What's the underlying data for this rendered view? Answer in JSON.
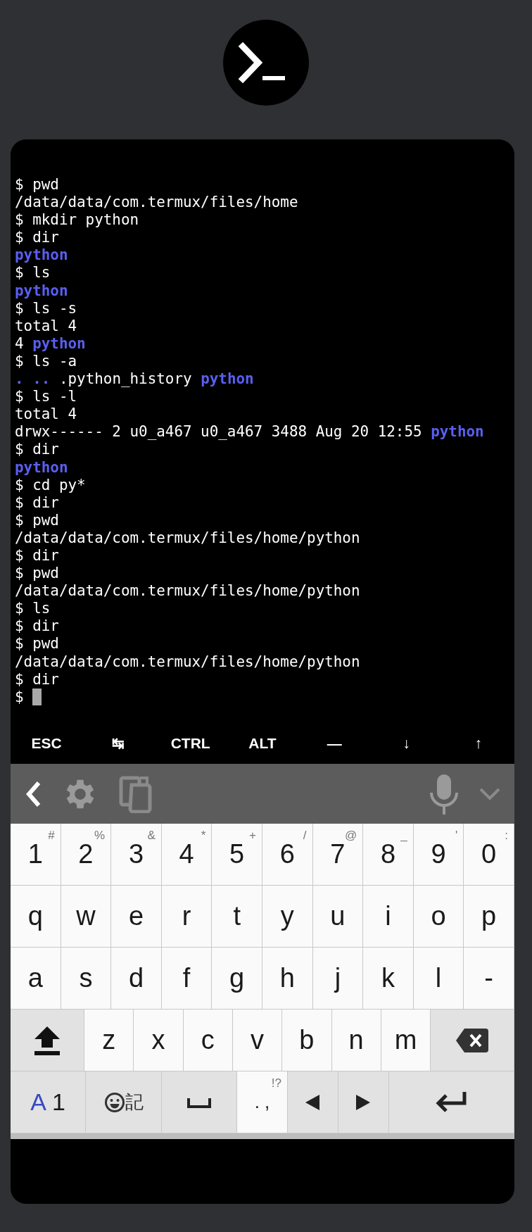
{
  "terminal": {
    "cursor_visible": true,
    "lines": [
      {
        "parts": [
          {
            "text": "$ pwd",
            "kind": "plain"
          }
        ]
      },
      {
        "parts": [
          {
            "text": "/data/data/com.termux/files/home",
            "kind": "plain"
          }
        ]
      },
      {
        "parts": [
          {
            "text": "$ mkdir python",
            "kind": "plain"
          }
        ]
      },
      {
        "parts": [
          {
            "text": "$ dir",
            "kind": "plain"
          }
        ]
      },
      {
        "parts": [
          {
            "text": "python",
            "kind": "directory"
          }
        ]
      },
      {
        "parts": [
          {
            "text": "$ ls",
            "kind": "plain"
          }
        ]
      },
      {
        "parts": [
          {
            "text": "python",
            "kind": "directory"
          }
        ]
      },
      {
        "parts": [
          {
            "text": "$ ls -s",
            "kind": "plain"
          }
        ]
      },
      {
        "parts": [
          {
            "text": "total 4",
            "kind": "plain"
          }
        ]
      },
      {
        "parts": [
          {
            "text": "4",
            "kind": "plain"
          },
          {
            "text": "python",
            "kind": "directory"
          }
        ]
      },
      {
        "parts": [
          {
            "text": "$ ls -a",
            "kind": "plain"
          }
        ]
      },
      {
        "parts": [
          {
            "text": ".",
            "kind": "directory"
          },
          {
            "text": "..",
            "kind": "directory"
          },
          {
            "text": ".python_history",
            "kind": "plain"
          },
          {
            "text": "python",
            "kind": "directory"
          }
        ]
      },
      {
        "parts": [
          {
            "text": "$ ls -l",
            "kind": "plain"
          }
        ]
      },
      {
        "parts": [
          {
            "text": "total 4",
            "kind": "plain"
          }
        ]
      },
      {
        "parts": [
          {
            "text": "drwx------ 2 u0_a467 u0_a467 3488 Aug 20 12:55",
            "kind": "plain"
          },
          {
            "text": "python",
            "kind": "directory"
          }
        ]
      },
      {
        "parts": [
          {
            "text": "$ dir",
            "kind": "plain"
          }
        ]
      },
      {
        "parts": [
          {
            "text": "python",
            "kind": "directory"
          }
        ]
      },
      {
        "parts": [
          {
            "text": "$ cd py*",
            "kind": "plain"
          }
        ]
      },
      {
        "parts": [
          {
            "text": "$ dir",
            "kind": "plain"
          }
        ]
      },
      {
        "parts": [
          {
            "text": "$ pwd",
            "kind": "plain"
          }
        ]
      },
      {
        "parts": [
          {
            "text": "/data/data/com.termux/files/home/python",
            "kind": "plain"
          }
        ]
      },
      {
        "parts": [
          {
            "text": "$ dir",
            "kind": "plain"
          }
        ]
      },
      {
        "parts": [
          {
            "text": "$ pwd",
            "kind": "plain"
          }
        ]
      },
      {
        "parts": [
          {
            "text": "/data/data/com.termux/files/home/python",
            "kind": "plain"
          }
        ]
      },
      {
        "parts": [
          {
            "text": "$ ls",
            "kind": "plain"
          }
        ]
      },
      {
        "parts": [
          {
            "text": "$ dir",
            "kind": "plain"
          }
        ]
      },
      {
        "parts": [
          {
            "text": "$ pwd",
            "kind": "plain"
          }
        ]
      },
      {
        "parts": [
          {
            "text": "/data/data/com.termux/files/home/python",
            "kind": "plain"
          }
        ]
      },
      {
        "parts": [
          {
            "text": "$ dir",
            "kind": "plain"
          }
        ]
      },
      {
        "parts": [
          {
            "text": "$",
            "kind": "plain"
          }
        ]
      }
    ]
  },
  "extra_keys": [
    "ESC",
    "↹",
    "CTRL",
    "ALT",
    "—",
    "↓",
    "↑"
  ],
  "keyboard": {
    "rows": [
      {
        "keys": [
          {
            "kind": "char",
            "label": "1",
            "hint": "#"
          },
          {
            "kind": "char",
            "label": "2",
            "hint": "%"
          },
          {
            "kind": "char",
            "label": "3",
            "hint": "&"
          },
          {
            "kind": "char",
            "label": "4",
            "hint": "*"
          },
          {
            "kind": "char",
            "label": "5",
            "hint": "+"
          },
          {
            "kind": "char",
            "label": "6",
            "hint": "/"
          },
          {
            "kind": "char",
            "label": "7",
            "hint": "@"
          },
          {
            "kind": "char",
            "label": "8",
            "hint": "_"
          },
          {
            "kind": "char",
            "label": "9",
            "hint": "'"
          },
          {
            "kind": "char",
            "label": "0",
            "hint": ":"
          }
        ]
      },
      {
        "keys": [
          {
            "kind": "char",
            "label": "q"
          },
          {
            "kind": "char",
            "label": "w"
          },
          {
            "kind": "char",
            "label": "e"
          },
          {
            "kind": "char",
            "label": "r"
          },
          {
            "kind": "char",
            "label": "t"
          },
          {
            "kind": "char",
            "label": "y"
          },
          {
            "kind": "char",
            "label": "u"
          },
          {
            "kind": "char",
            "label": "i"
          },
          {
            "kind": "char",
            "label": "o"
          },
          {
            "kind": "char",
            "label": "p"
          }
        ]
      },
      {
        "keys": [
          {
            "kind": "char",
            "label": "a"
          },
          {
            "kind": "char",
            "label": "s"
          },
          {
            "kind": "char",
            "label": "d"
          },
          {
            "kind": "char",
            "label": "f"
          },
          {
            "kind": "char",
            "label": "g"
          },
          {
            "kind": "char",
            "label": "h"
          },
          {
            "kind": "char",
            "label": "j"
          },
          {
            "kind": "char",
            "label": "k"
          },
          {
            "kind": "char",
            "label": "l"
          },
          {
            "kind": "char",
            "label": "-"
          }
        ]
      },
      {
        "keys": [
          {
            "kind": "shift"
          },
          {
            "kind": "letter",
            "label": "z"
          },
          {
            "kind": "letter",
            "label": "x"
          },
          {
            "kind": "letter",
            "label": "c"
          },
          {
            "kind": "letter",
            "label": "v"
          },
          {
            "kind": "letter",
            "label": "b"
          },
          {
            "kind": "letter",
            "label": "n"
          },
          {
            "kind": "letter",
            "label": "m"
          },
          {
            "kind": "backspace"
          }
        ]
      },
      {
        "keys": [
          {
            "kind": "mode",
            "label": "A",
            "label_secondary": "1"
          },
          {
            "kind": "emoji",
            "label": "記"
          },
          {
            "kind": "space"
          },
          {
            "kind": "punct",
            "label": ". ,",
            "hint": "!?"
          },
          {
            "kind": "left"
          },
          {
            "kind": "right"
          },
          {
            "kind": "enter"
          }
        ]
      }
    ]
  }
}
